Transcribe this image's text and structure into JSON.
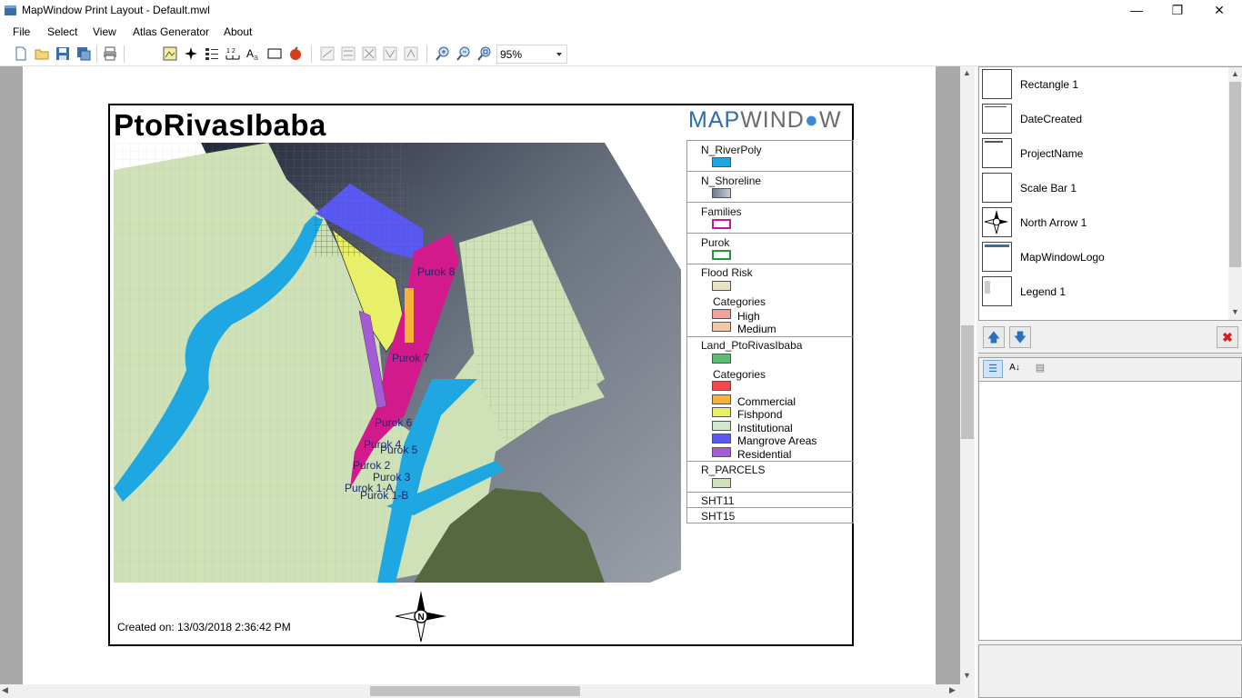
{
  "window": {
    "title": "MapWindow Print Layout - Default.mwl"
  },
  "menu": [
    "File",
    "Select",
    "View",
    "Atlas Generator",
    "About"
  ],
  "toolbar": {
    "icons": [
      "new-icon",
      "open-icon",
      "save-icon",
      "save-as-icon",
      "print-icon",
      "map-icon",
      "north-arrow-icon",
      "legend-icon",
      "scale-bar-icon",
      "label-icon",
      "rectangle-icon",
      "image-icon",
      "align-left-icon",
      "align-right-icon",
      "align-top-icon",
      "align-bottom-icon",
      "fit-icon",
      "zoom-in-icon",
      "zoom-out-icon",
      "zoom-extent-icon"
    ],
    "zoom_value": "95%"
  },
  "layout": {
    "project_name": "PtoRivasIbaba",
    "logo_text_a": "MAP",
    "logo_text_b": "WIND",
    "logo_text_c": "W",
    "date_created": "Created on: 13/03/2018 2:36:42 PM",
    "north_label": "N",
    "map_labels": [
      "Purok 8",
      "Purok 7",
      "Purok 6",
      "Purok 4",
      "Purok 5",
      "Purok 2",
      "Purok 3",
      "Purok 1-A",
      "Purok 1-B"
    ]
  },
  "legend": {
    "sections": [
      {
        "title": "N_RiverPoly",
        "swatch": "#1ea7e1"
      },
      {
        "title": "N_Shoreline",
        "swatch": "#8a93a6"
      },
      {
        "title": "Families",
        "swatch": "#ffffff",
        "border": "#c2189b"
      },
      {
        "title": "Purok",
        "swatch": "#ffffff",
        "border": "#1a9c3e"
      },
      {
        "title": "Flood Risk",
        "swatch": "#e8e3c8",
        "categories_label": "Categories",
        "categories": [
          {
            "label": "High",
            "color": "#f2a0a0"
          },
          {
            "label": "Medium",
            "color": "#f3c6a4"
          }
        ]
      },
      {
        "title": "Land_PtoRivasIbaba",
        "swatch": "#5dbb73",
        "categories_label": "Categories",
        "categories": [
          {
            "label": "",
            "color": "#f04a4a"
          },
          {
            "label": "Commercial",
            "color": "#f7b13d"
          },
          {
            "label": "Fishpond",
            "color": "#e8f06a"
          },
          {
            "label": "Institutional",
            "color": "#cfe9cf"
          },
          {
            "label": "Mangrove Areas",
            "color": "#5a5af0"
          },
          {
            "label": "Residential",
            "color": "#a55ad6"
          }
        ]
      },
      {
        "title": "R_PARCELS",
        "swatch": "#cfe2bb"
      },
      {
        "title": "SHT11"
      },
      {
        "title": "SHT15"
      }
    ]
  },
  "elements_list": [
    {
      "label": "Rectangle 1",
      "thumb": "rectangle"
    },
    {
      "label": "DateCreated",
      "thumb": "text"
    },
    {
      "label": "ProjectName",
      "thumb": "text"
    },
    {
      "label": "Scale Bar 1",
      "thumb": "blank"
    },
    {
      "label": "North Arrow 1",
      "thumb": "north"
    },
    {
      "label": "MapWindowLogo",
      "thumb": "logo"
    },
    {
      "label": "Legend 1",
      "thumb": "legend"
    }
  ]
}
